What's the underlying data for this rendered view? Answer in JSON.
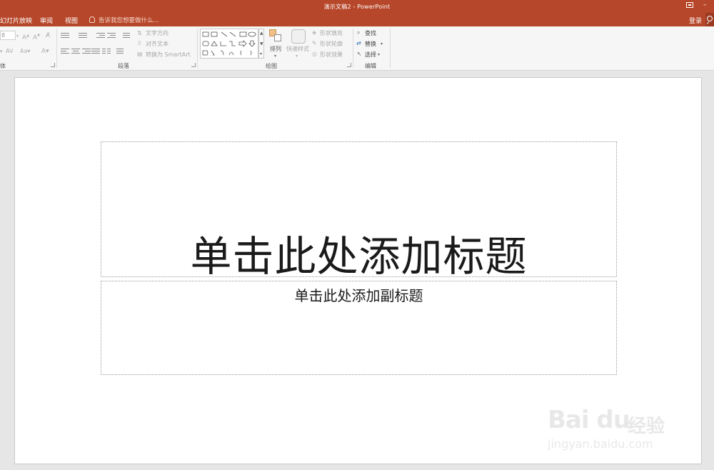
{
  "window": {
    "title": "演示文稿2 - PowerPoint",
    "login": "登录"
  },
  "tabs": [
    {
      "label": "幻灯片放映"
    },
    {
      "label": "审阅"
    },
    {
      "label": "视图"
    }
  ],
  "tell_me": {
    "placeholder": "告诉我您想要做什么..."
  },
  "ribbon": {
    "font": {
      "size_value": "8",
      "group_label": "体"
    },
    "paragraph": {
      "text_direction": "文字方向",
      "align_text": "对齐文本",
      "convert_smartart": "转换为 SmartArt",
      "group_label": "段落"
    },
    "drawing": {
      "arrange": "排列",
      "quick_styles": "快速样式",
      "shape_fill": "形状填充",
      "shape_outline": "形状轮廓",
      "shape_effects": "形状效果",
      "group_label": "绘图"
    },
    "editing": {
      "find": "查找",
      "replace": "替换",
      "select": "选择",
      "group_label": "编辑"
    }
  },
  "slide": {
    "title_placeholder": "单击此处添加标题",
    "subtitle_placeholder": "单击此处添加副标题"
  },
  "watermark": {
    "logo": "Bai du",
    "cn": "经验",
    "url": "jingyan.baidu.com"
  },
  "colors": {
    "titlebar": "#b7472a",
    "ribbon": "#f6f6f6",
    "workspace": "#e6e6e6"
  }
}
